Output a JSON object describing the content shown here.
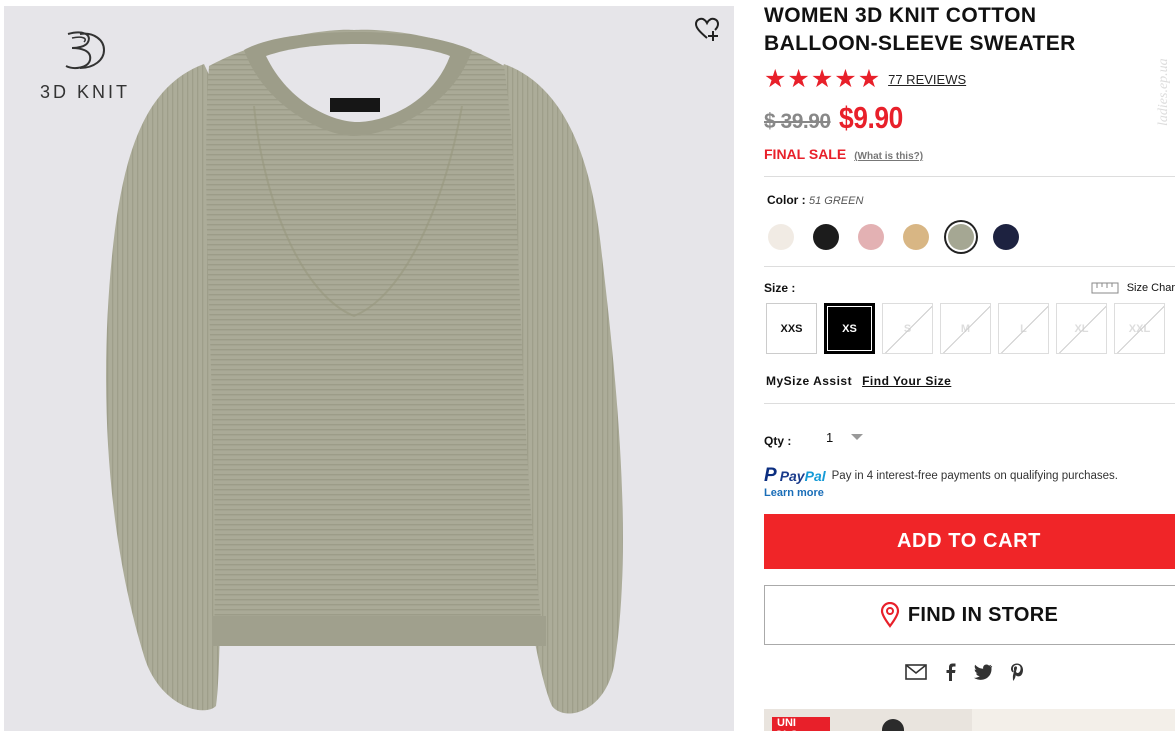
{
  "brand_badge": {
    "text": "3D KNIT"
  },
  "product": {
    "title": "WOMEN 3D KNIT COTTON BALLOON-SLEEVE SWEATER",
    "reviews_label": "77 REVIEWS",
    "rating": 5,
    "old_price": "$ 39.90",
    "new_price": "$9.90",
    "final_sale": "FINAL SALE",
    "what_is_this": "(What is this?)",
    "watermark": "ladies.ep.ua"
  },
  "color": {
    "label": "Color :",
    "selected_name": "51 GREEN",
    "swatches": [
      {
        "name": "off-white",
        "hex": "#f1ebe4"
      },
      {
        "name": "black",
        "hex": "#1c1c1c"
      },
      {
        "name": "pink",
        "hex": "#e3b1b3"
      },
      {
        "name": "beige",
        "hex": "#d8b684"
      },
      {
        "name": "green",
        "hex": "#a5a793"
      },
      {
        "name": "navy",
        "hex": "#1d2240"
      }
    ]
  },
  "size": {
    "label": "Size :",
    "chart_label": "Size Char",
    "options": [
      {
        "label": "XXS",
        "state": "available"
      },
      {
        "label": "XS",
        "state": "selected"
      },
      {
        "label": "S",
        "state": "unavailable"
      },
      {
        "label": "M",
        "state": "unavailable"
      },
      {
        "label": "L",
        "state": "unavailable"
      },
      {
        "label": "XL",
        "state": "unavailable"
      },
      {
        "label": "XXL",
        "state": "unavailable"
      }
    ]
  },
  "mysize": {
    "label": "MySize Assist",
    "link": "Find Your Size"
  },
  "qty": {
    "label": "Qty :",
    "value": "1"
  },
  "paypal": {
    "logo_pay": "Pay",
    "logo_pal": "Pal",
    "message": "Pay in 4 interest-free payments on qualifying purchases.",
    "learn_more": "Learn more"
  },
  "actions": {
    "add_to_cart": "ADD TO CART",
    "find_in_store": "FIND IN STORE"
  },
  "promo": {
    "logo_text": "UNI QLO"
  },
  "colors": {
    "accent": "#e8202a",
    "button": "#f02528",
    "garment": "#a9a996"
  }
}
